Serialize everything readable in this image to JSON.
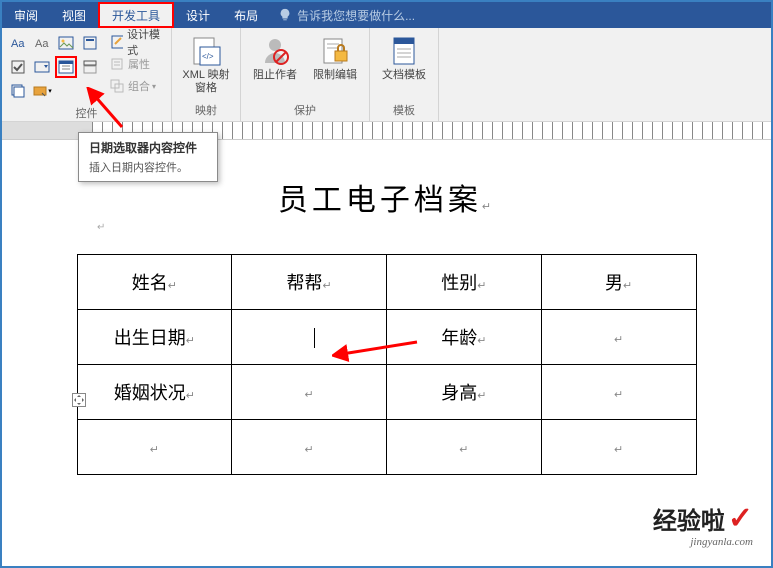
{
  "tabs": {
    "review": "审阅",
    "view": "视图",
    "developer": "开发工具",
    "design": "设计",
    "layout": "布局"
  },
  "tellMe": "告诉我您想要做什么...",
  "ribbon": {
    "controls": {
      "label": "控件",
      "designMode": "设计模式",
      "properties": "属性",
      "combine": "组合"
    },
    "mapping": {
      "label": "映射",
      "xmlPane": "XML 映射窗格"
    },
    "protect": {
      "label": "保护",
      "blockAuthors": "阻止作者",
      "restrictEdit": "限制编辑"
    },
    "template": {
      "label": "模板",
      "docTemplate": "文档模板"
    }
  },
  "tooltip": {
    "title": "日期选取器内容控件",
    "desc": "插入日期内容控件。"
  },
  "doc": {
    "title": "员工电子档案",
    "table": {
      "r1c1": "姓名",
      "r1c2": "帮帮",
      "r1c3": "性别",
      "r1c4": "男",
      "r2c1": "出生日期",
      "r2c2": "",
      "r2c3": "年龄",
      "r2c4": "",
      "r3c1": "婚姻状况",
      "r3c2": "",
      "r3c3": "身高",
      "r3c4": "",
      "r4c1": "",
      "r4c2": "",
      "r4c3": "",
      "r4c4": ""
    }
  },
  "watermark": {
    "main": "经验啦",
    "sub": "jingyanla.com"
  }
}
